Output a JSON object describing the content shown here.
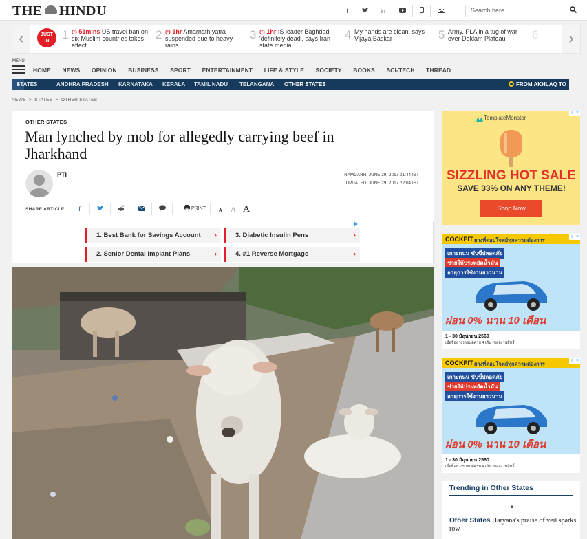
{
  "header": {
    "logo_left": "THE",
    "logo_right": "HINDU",
    "social": [
      "f",
      "t",
      "in",
      "yt",
      "m",
      "kb"
    ],
    "search_placeholder": "Search here"
  },
  "just_in": {
    "badge_line1": "JUST",
    "badge_line2": "IN",
    "items": [
      {
        "num": "1",
        "time": "51mins",
        "text": "US travel ban on six Muslim countries takes effect"
      },
      {
        "num": "2",
        "time": "1hr",
        "text": "Amarnath yatra suspended due to heavy rains"
      },
      {
        "num": "3",
        "time": "1hr",
        "text": "IS leader Baghdadi 'definitely dead', says Iran state media"
      },
      {
        "num": "4",
        "time": "",
        "text": "My hands are clean, says Vijaya Baskar"
      },
      {
        "num": "5",
        "time": "",
        "text": "Army, PLA in a tug of war over Doklam Plateau"
      },
      {
        "num": "6",
        "time": "",
        "text": ""
      }
    ]
  },
  "nav": {
    "menu_label": "MENU",
    "items": [
      "HOME",
      "NEWS",
      "OPINION",
      "BUSINESS",
      "SPORT",
      "ENTERTAINMENT",
      "LIFE & STYLE",
      "SOCIETY",
      "BOOKS",
      "SCI-TECH",
      "THREAD"
    ],
    "states_label": "STATES",
    "states": [
      "ANDHRA PRADESH",
      "KARNATAKA",
      "KERALA",
      "TAMIL NADU",
      "TELANGANA",
      "OTHER STATES"
    ],
    "ticker": "FROM AKHLAQ TO"
  },
  "breadcrumb": [
    "NEWS",
    "STATES",
    "OTHER STATES"
  ],
  "article": {
    "section": "OTHER STATES",
    "title": "Man lynched by mob for allegedly carrying beef in Jharkhand",
    "author": "PTI",
    "dateline": "RAMGARH, JUNE 29, 2017 21:44 IST",
    "updated": "UPDATED: JUNE 29, 2017 22:04 IST",
    "share_label": "SHARE ARTICLE",
    "print_label": "PRINT"
  },
  "ad_links": [
    {
      "label": "1.  Best Bank for Savings Account"
    },
    {
      "label": "3.  Diabetic Insulin Pens"
    },
    {
      "label": "2.  Senior Dental Implant Plans"
    },
    {
      "label": "4.  #1 Reverse Mortgage"
    }
  ],
  "ad_template": {
    "brand": "TemplateMonster",
    "headline": "SIZZLING HOT SALE",
    "subline": "SAVE 33% ON ANY THEME!",
    "cta": "Shop Now"
  },
  "ad_car": {
    "brand": "COCKPIT",
    "top_text": "ยางที่ตอบโจทย์ทุกความต้องการ",
    "line1": "เกาะถนน ขับขี่ปลอดภัย",
    "line2": "ช่วยให้ประหยัดน้ำมัน",
    "line3": "อายุการใช้งานยาวนาน",
    "promo": "ผ่อน 0% นาน 10 เดือน",
    "dates": "1 - 30 มิถุนายน 2560",
    "fineprint": "เมื่อซื้อยางรถยนต์ครบ 4 เส้น (ขอสงวนสิทธิ์)"
  },
  "trending": {
    "heading": "Trending in Other States",
    "item_section": "Other States",
    "item_text": "Haryana's praise of veil sparks row"
  }
}
